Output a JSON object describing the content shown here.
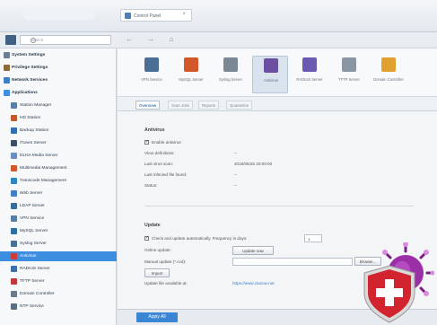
{
  "window": {
    "tab_title": "Control Panel",
    "tab_close": "×"
  },
  "search": {
    "placeholder": "Search"
  },
  "nav": {
    "buttons": "← → ⌂"
  },
  "sidebar": {
    "items": [
      {
        "label": "System Settings",
        "group": true
      },
      {
        "label": "Privilege Settings",
        "group": true
      },
      {
        "label": "Network Services",
        "group": true
      },
      {
        "label": "Applications",
        "group": true
      },
      {
        "label": "Station Manager"
      },
      {
        "label": "HD Station"
      },
      {
        "label": "Backup Station"
      },
      {
        "label": "iTunes Server"
      },
      {
        "label": "DLNA Media Server"
      },
      {
        "label": "Multimedia Management"
      },
      {
        "label": "Transcode Management"
      },
      {
        "label": "Web Server"
      },
      {
        "label": "LDAP Server"
      },
      {
        "label": "VPN Service"
      },
      {
        "label": "MySQL Server"
      },
      {
        "label": "Syslog Server"
      },
      {
        "label": "Antivirus",
        "selected": true
      },
      {
        "label": "RADIUS Server"
      },
      {
        "label": "TFTP Server"
      },
      {
        "label": "Domain Controller"
      },
      {
        "label": "NTP Service"
      }
    ]
  },
  "apps": [
    {
      "label": "VPN Service"
    },
    {
      "label": "MySQL Server"
    },
    {
      "label": "Syslog Server"
    },
    {
      "label": "Antivirus",
      "active": true
    },
    {
      "label": "RADIUS Server"
    },
    {
      "label": "TFTP Server"
    },
    {
      "label": "Domain Controller"
    }
  ],
  "subtabs": [
    "Overview",
    "Scan Jobs",
    "Reports",
    "Quarantine"
  ],
  "antivirus": {
    "title": "Antivirus",
    "enable_label": "Enable antivirus",
    "rows": [
      {
        "label": "Virus definitions:",
        "value": "--"
      },
      {
        "label": "Last virus scan:",
        "value": "2015/05/26 20:00:00"
      },
      {
        "label": "Last infected file found:",
        "value": "--"
      },
      {
        "label": "Status:",
        "value": "--"
      }
    ]
  },
  "update": {
    "title": "Update",
    "auto_check_label": "Check and update automatically. Frequency in days:",
    "frequency": "1",
    "online_label": "Online update:",
    "update_now": "Update now",
    "manual_label": "Manual update (*.cvd):",
    "browse": "Browse...",
    "import": "Import",
    "available_label": "Update file available at:",
    "available_link": "https://www.clamav.net"
  },
  "footer": {
    "apply": "Apply All"
  }
}
